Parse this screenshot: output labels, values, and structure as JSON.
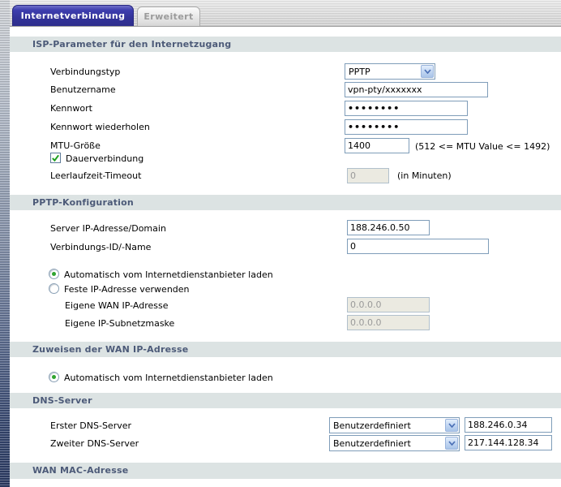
{
  "tabs": [
    {
      "label": "Internetverbindung",
      "active": true
    },
    {
      "label": "Erweitert",
      "active": false
    }
  ],
  "isp": {
    "title": "ISP-Parameter für den Internetzugang",
    "connection_type": {
      "label": "Verbindungstyp",
      "value": "PPTP"
    },
    "username": {
      "label": "Benutzername",
      "value": "vpn-pty/xxxxxxx"
    },
    "password": {
      "label": "Kennwort",
      "value": "••••••••"
    },
    "password_repeat": {
      "label": "Kennwort wiederholen",
      "value": "••••••••"
    },
    "mtu": {
      "label": "MTU-Größe",
      "value": "1400",
      "note": "(512 <= MTU Value <= 1492)"
    },
    "keepalive": {
      "label": "Dauerverbindung",
      "checked": true
    },
    "idle_timeout": {
      "label": "Leerlaufzeit-Timeout",
      "value": "0",
      "note": "(in Minuten)",
      "disabled": true
    }
  },
  "pptp": {
    "title": "PPTP-Konfiguration",
    "server": {
      "label": "Server IP-Adresse/Domain",
      "value": "188.246.0.50"
    },
    "connection_id": {
      "label": "Verbindungs-ID/-Name",
      "value": "0"
    },
    "auto_option": {
      "label": "Automatisch vom Internetdienstanbieter laden",
      "selected": true
    },
    "static_option": {
      "label": "Feste IP-Adresse verwenden",
      "selected": false
    },
    "wan_ip": {
      "label": "Eigene WAN IP-Adresse",
      "value": "0.0.0.0",
      "disabled": true
    },
    "subnet": {
      "label": "Eigene IP-Subnetzmaske",
      "value": "0.0.0.0",
      "disabled": true
    }
  },
  "wan_ip_assign": {
    "title": "Zuweisen der WAN IP-Adresse",
    "auto_option": {
      "label": "Automatisch vom Internetdienstanbieter laden",
      "selected": true
    }
  },
  "dns": {
    "title": "DNS-Server",
    "first": {
      "label": "Erster DNS-Server",
      "mode": "Benutzerdefiniert",
      "value": "188.246.0.34"
    },
    "second": {
      "label": "Zweiter DNS-Server",
      "mode": "Benutzerdefiniert",
      "value": "217.144.128.34"
    }
  },
  "wan_mac": {
    "title": "WAN MAC-Adresse"
  },
  "colors": {
    "tab_active_bg": "#333399",
    "section_band_bg": "#dce3e3",
    "section_band_text": "#4c5a78",
    "input_border": "#7f9db9",
    "check_green": "#2fa42f"
  }
}
